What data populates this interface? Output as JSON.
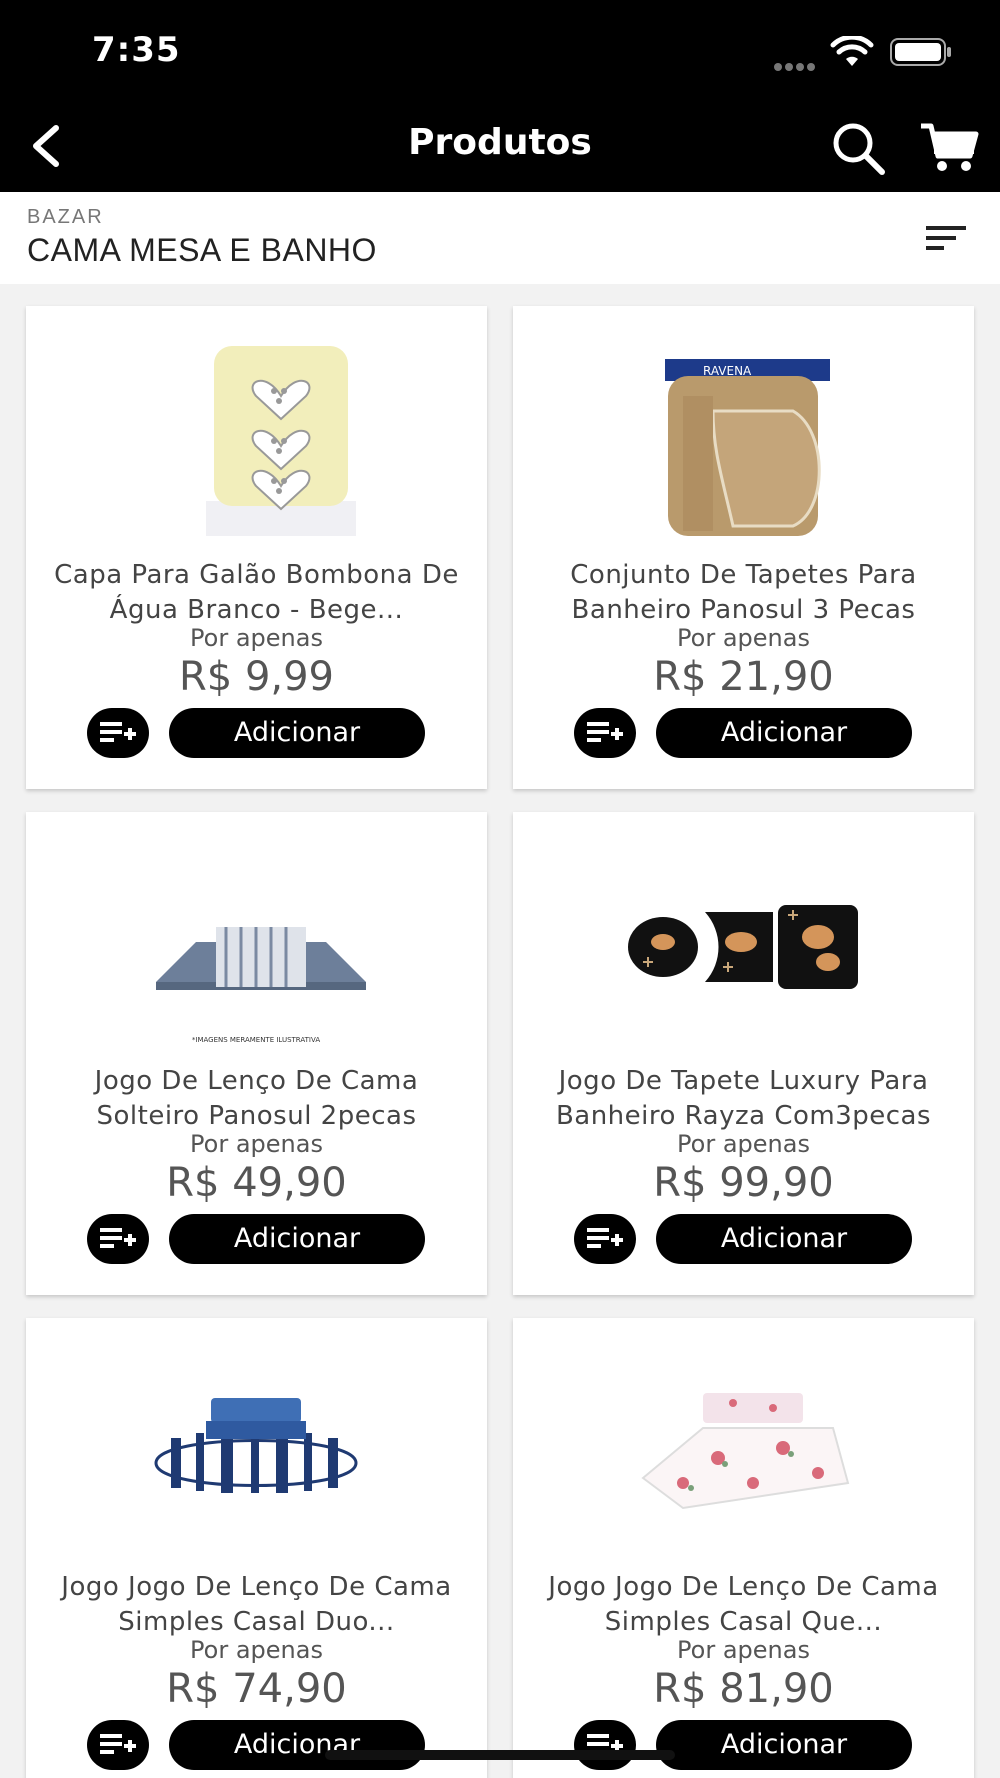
{
  "status": {
    "time": "7:35"
  },
  "nav": {
    "title": "Produtos"
  },
  "category": {
    "parent": "BAZAR",
    "name": "CAMA MESA E BANHO"
  },
  "products": [
    {
      "title": "Capa Para Galão Bombona De Água Branco - Bege...",
      "price_prefix": "Por apenas",
      "price": "R$ 9,99",
      "add_label": "Adicionar",
      "image_icon": "water-jug-cover-image"
    },
    {
      "title": "Conjunto De Tapetes Para Banheiro Panosul 3 Pecas",
      "price_prefix": "Por apenas",
      "price": "R$ 21,90",
      "add_label": "Adicionar",
      "image_icon": "bath-mat-set-image",
      "image_brand": "RAVENA"
    },
    {
      "title": "Jogo De Lenço De Cama Solteiro Panosul 2pecas",
      "price_prefix": "Por apenas",
      "price": "R$ 49,90",
      "add_label": "Adicionar",
      "image_icon": "bed-sheet-image",
      "image_caption": "*IMAGENS MERAMENTE ILUSTRATIVA"
    },
    {
      "title": "Jogo De Tapete Luxury Para Banheiro Rayza Com3pecas",
      "price_prefix": "Por apenas",
      "price": "R$ 99,90",
      "add_label": "Adicionar",
      "image_icon": "luxury-bath-mat-image"
    },
    {
      "title": "Jogo Jogo De Lenço De Cama Simples Casal Duo...",
      "price_prefix": "Por apenas",
      "price": "R$ 74,90",
      "add_label": "Adicionar",
      "image_icon": "blue-bedding-image"
    },
    {
      "title": "Jogo Jogo De Lenço De Cama Simples Casal Que...",
      "price_prefix": "Por apenas",
      "price": "R$ 81,90",
      "add_label": "Adicionar",
      "image_icon": "floral-bedding-image"
    }
  ],
  "colors": {
    "bar": "#000000",
    "background": "#f2f2f2",
    "card": "#ffffff",
    "button": "#000000"
  }
}
